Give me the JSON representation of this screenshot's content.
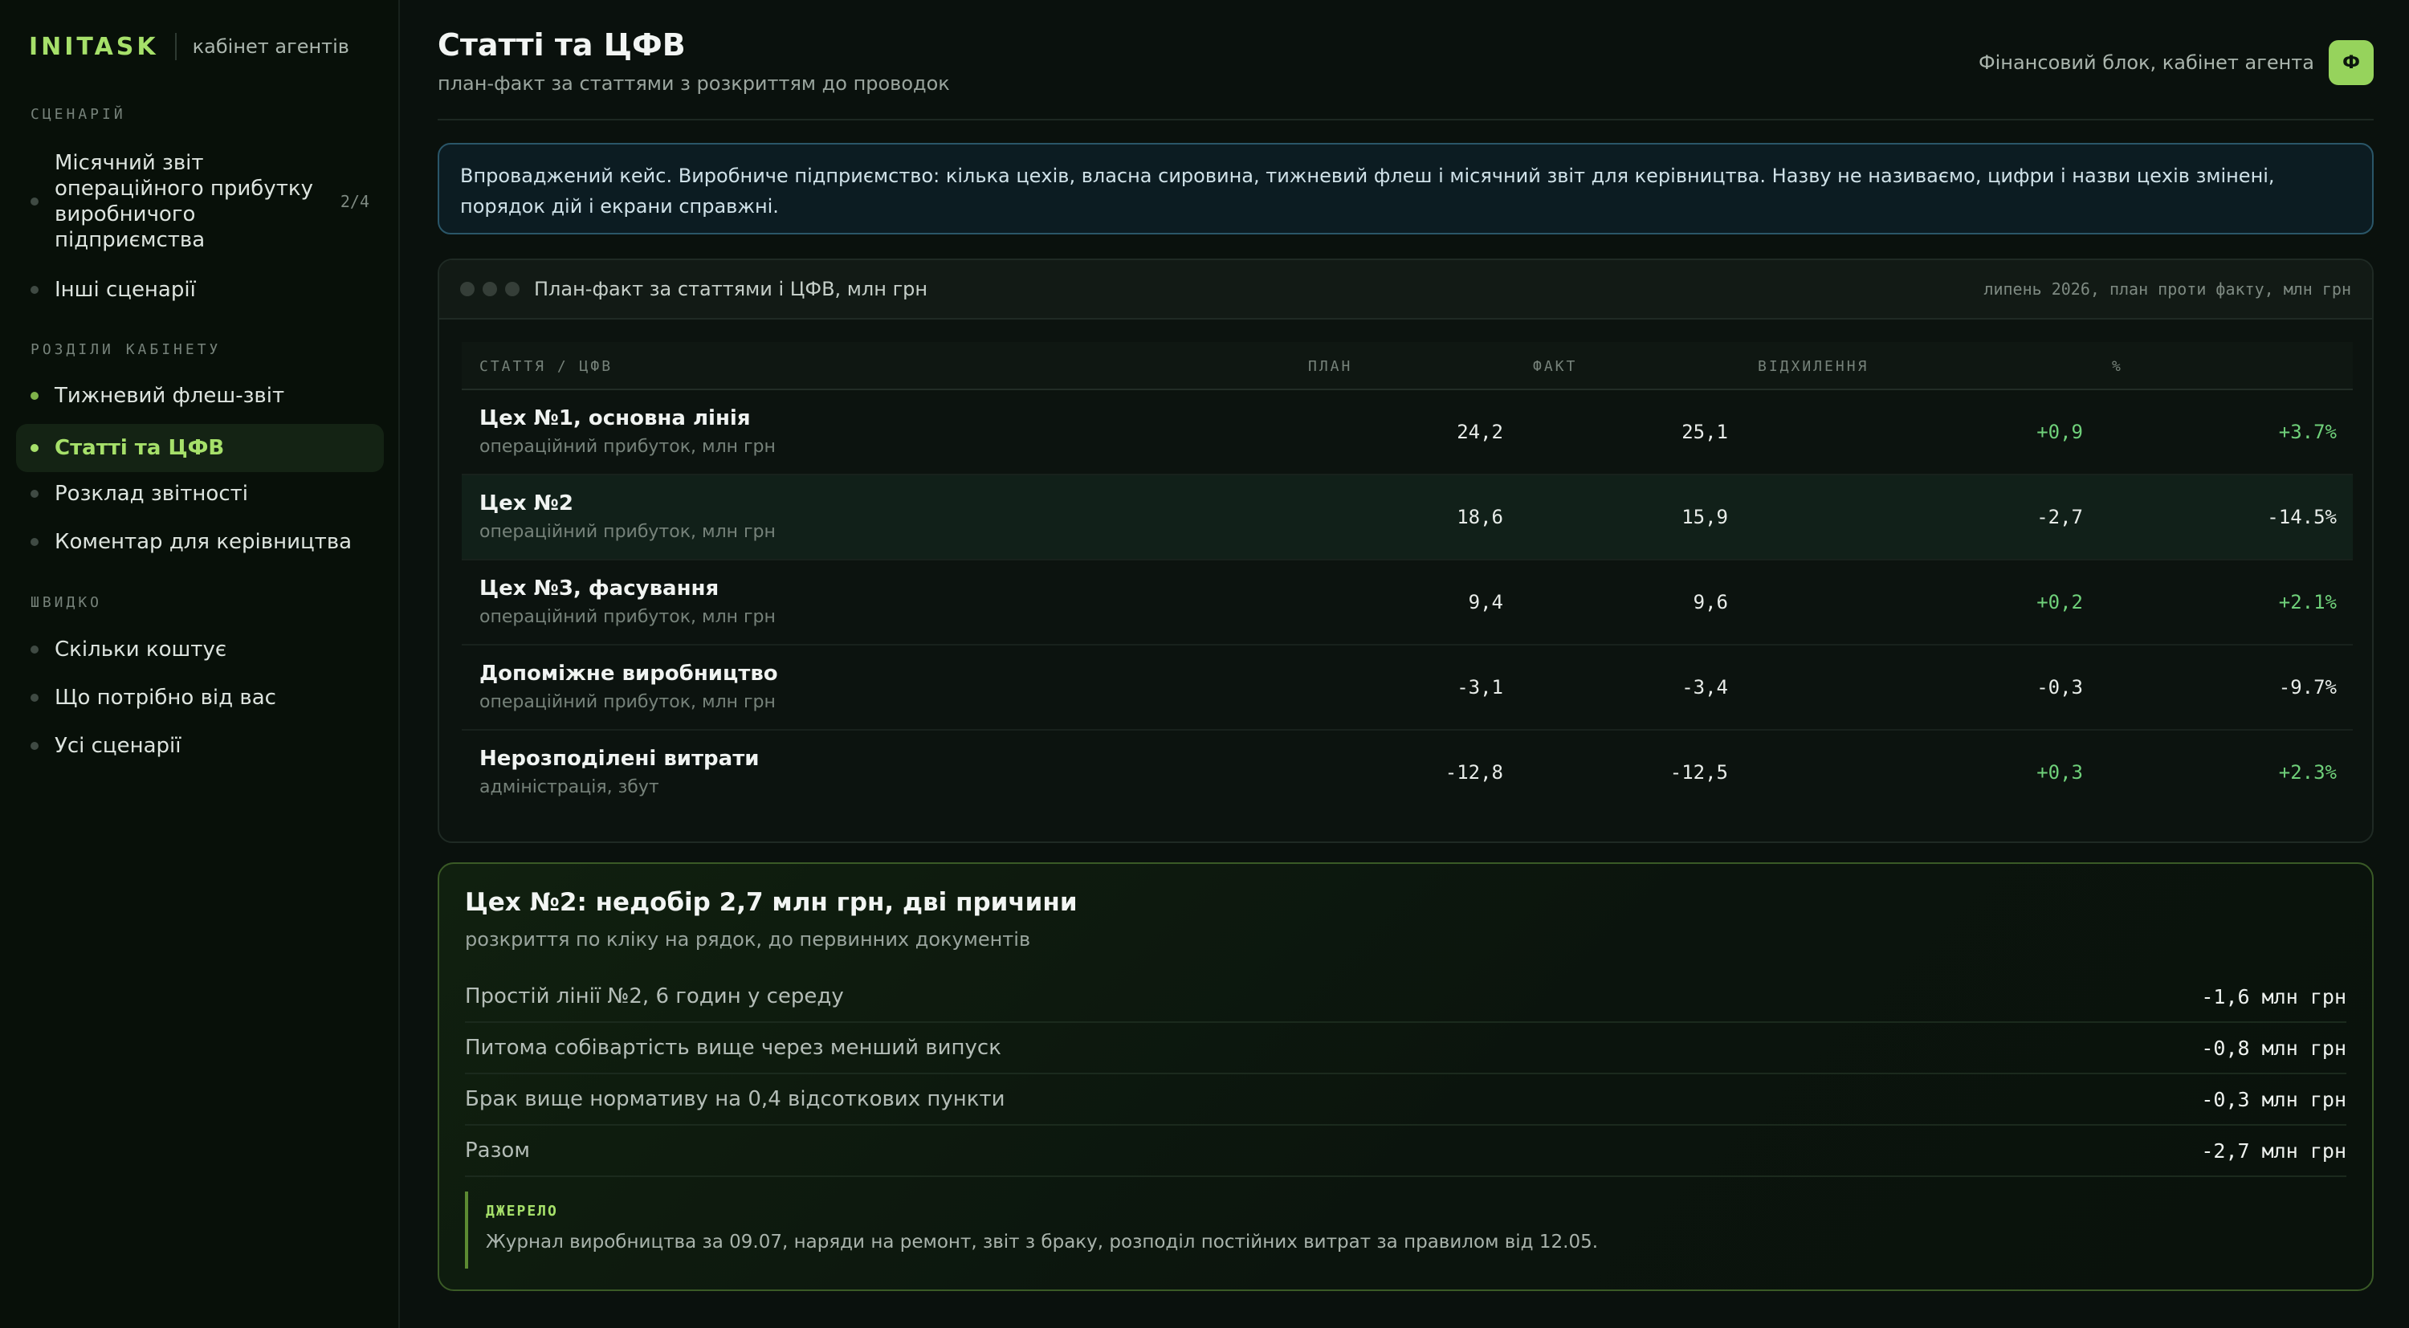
{
  "brand": {
    "logo": "INITASK",
    "subtitle": "кабінет агентів"
  },
  "sidebar": {
    "sections": [
      {
        "title": "СЦЕНАРІЙ",
        "items": [
          {
            "label": "Місячний звіт операційного прибутку виробничого підприємства",
            "counter": "2/4"
          },
          {
            "label": "Інші сценарії"
          }
        ]
      },
      {
        "title": "РОЗДІЛИ КАБІНЕТУ",
        "items": [
          {
            "label": "Тижневий флеш-звіт"
          },
          {
            "label": "Статті та ЦФВ",
            "active": true
          },
          {
            "label": "Розклад звітності"
          },
          {
            "label": "Коментар для керівництва"
          }
        ]
      },
      {
        "title": "ШВИДКО",
        "items": [
          {
            "label": "Скільки коштує"
          },
          {
            "label": "Що потрібно від вас"
          },
          {
            "label": "Усі сценарії"
          }
        ]
      }
    ]
  },
  "header": {
    "title": "Статті та ЦФВ",
    "subtitle": "план-факт за статтями з розкриттям до проводок",
    "context": "Фінансовий блок, кабінет агента",
    "avatar": "Ф"
  },
  "banner": {
    "text": "Впроваджений кейс. Виробниче підприємство: кілька цехів, власна сировина, тижневий флеш і місячний звіт для керівництва. Назву не називаємо, цифри і назви цехів змінені, порядок дій і екрани справжні."
  },
  "table_window": {
    "title": "План-факт за статтями і ЦФВ, млн грн",
    "meta": "липень 2026, план проти факту, млн грн",
    "columns": {
      "name": "СТАТТЯ / ЦФВ",
      "plan": "ПЛАН",
      "fact": "ФАКТ",
      "deviation": "ВІДХИЛЕННЯ",
      "percent": "%"
    },
    "rows": [
      {
        "name": "Цех №1, основна лінія",
        "desc": "операційний прибуток, млн грн",
        "plan": "24,2",
        "fact": "25,1",
        "deviation": "+0,9",
        "percent": "+3.7%",
        "positive": true
      },
      {
        "name": "Цех №2",
        "desc": "операційний прибуток, млн грн",
        "plan": "18,6",
        "fact": "15,9",
        "deviation": "-2,7",
        "percent": "-14.5%",
        "positive": false,
        "selected": true
      },
      {
        "name": "Цех №3, фасування",
        "desc": "операційний прибуток, млн грн",
        "plan": "9,4",
        "fact": "9,6",
        "deviation": "+0,2",
        "percent": "+2.1%",
        "positive": true
      },
      {
        "name": "Допоміжне виробництво",
        "desc": "операційний прибуток, млн грн",
        "plan": "-3,1",
        "fact": "-3,4",
        "deviation": "-0,3",
        "percent": "-9.7%",
        "positive": false
      },
      {
        "name": "Нерозподілені витрати",
        "desc": "адміністрація, збут",
        "plan": "-12,8",
        "fact": "-12,5",
        "deviation": "+0,3",
        "percent": "+2.3%",
        "positive": true
      }
    ]
  },
  "drilldown": {
    "title": "Цех №2: недобір 2,7 млн грн, дві причини",
    "subtitle": "розкриття по кліку на рядок, до первинних документів",
    "items": [
      {
        "label": "Простій лінії №2, 6 годин у середу",
        "value": "-1,6 млн грн"
      },
      {
        "label": "Питома собівартість вище через менший випуск",
        "value": "-0,8 млн грн"
      },
      {
        "label": "Брак вище нормативу на 0,4 відсоткових пункти",
        "value": "-0,3 млн грн"
      },
      {
        "label": "Разом",
        "value": "-2,7 млн грн"
      }
    ],
    "source_label": "ДЖЕРЕЛО",
    "source_text": "Журнал виробництва за 09.07, наряди на ремонт, звіт з браку, розподіл постійних витрат за правилом від 12.05."
  },
  "colors": {
    "accent": "#a6e06a",
    "positive": "#6fd07a",
    "banner_border": "#2a5668"
  }
}
